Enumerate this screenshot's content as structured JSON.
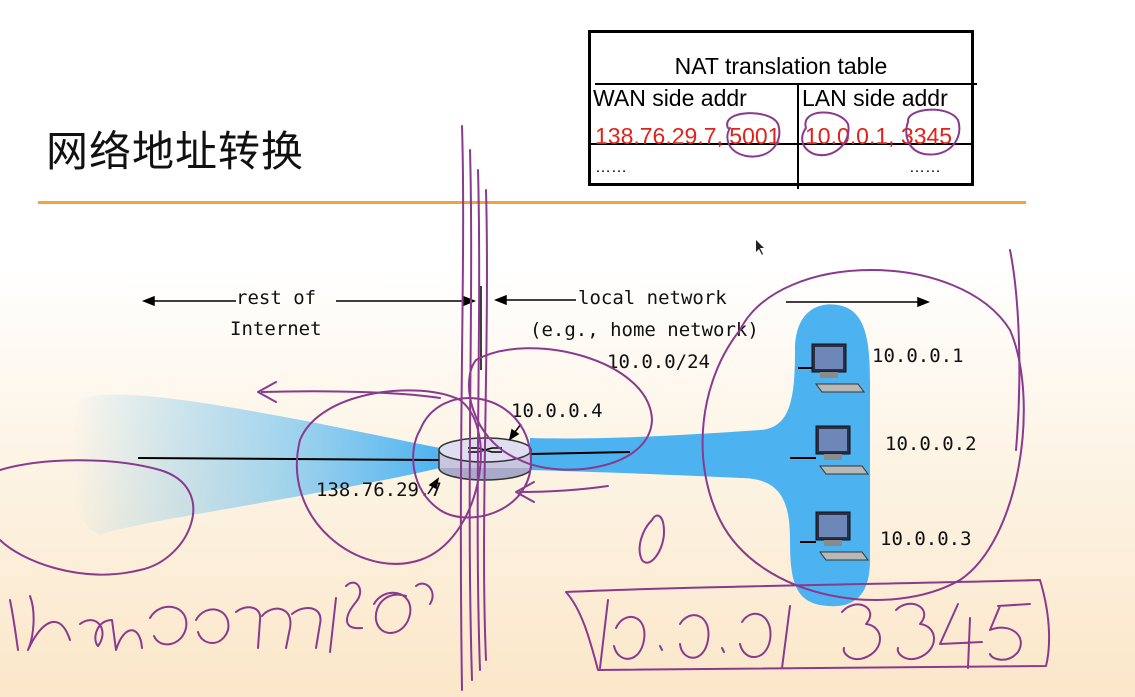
{
  "slide": {
    "title": "网络地址转换"
  },
  "nat_table": {
    "caption": "NAT translation table",
    "headers": [
      "WAN side addr",
      "LAN side addr"
    ],
    "rows": [
      {
        "wan": "138.76.29.7, 5001",
        "lan": "10.0.0.1, 3345"
      },
      {
        "wan": "……",
        "lan": "……"
      }
    ],
    "entry_color": "#e0221b"
  },
  "diagram": {
    "rest_of_internet": [
      "rest of",
      "Internet"
    ],
    "local_network": [
      "local network",
      "(e.g., home network)",
      "10.0.0/24"
    ],
    "router": {
      "lan_ip": "10.0.0.4",
      "wan_ip": "138.76.29.7"
    },
    "hosts": [
      "10.0.0.1",
      "10.0.0.2",
      "10.0.0.3"
    ],
    "colors": {
      "network_fill": "#4db3f0",
      "ink": "#8a3a8e",
      "title_rule": "#f2a33c"
    }
  }
}
